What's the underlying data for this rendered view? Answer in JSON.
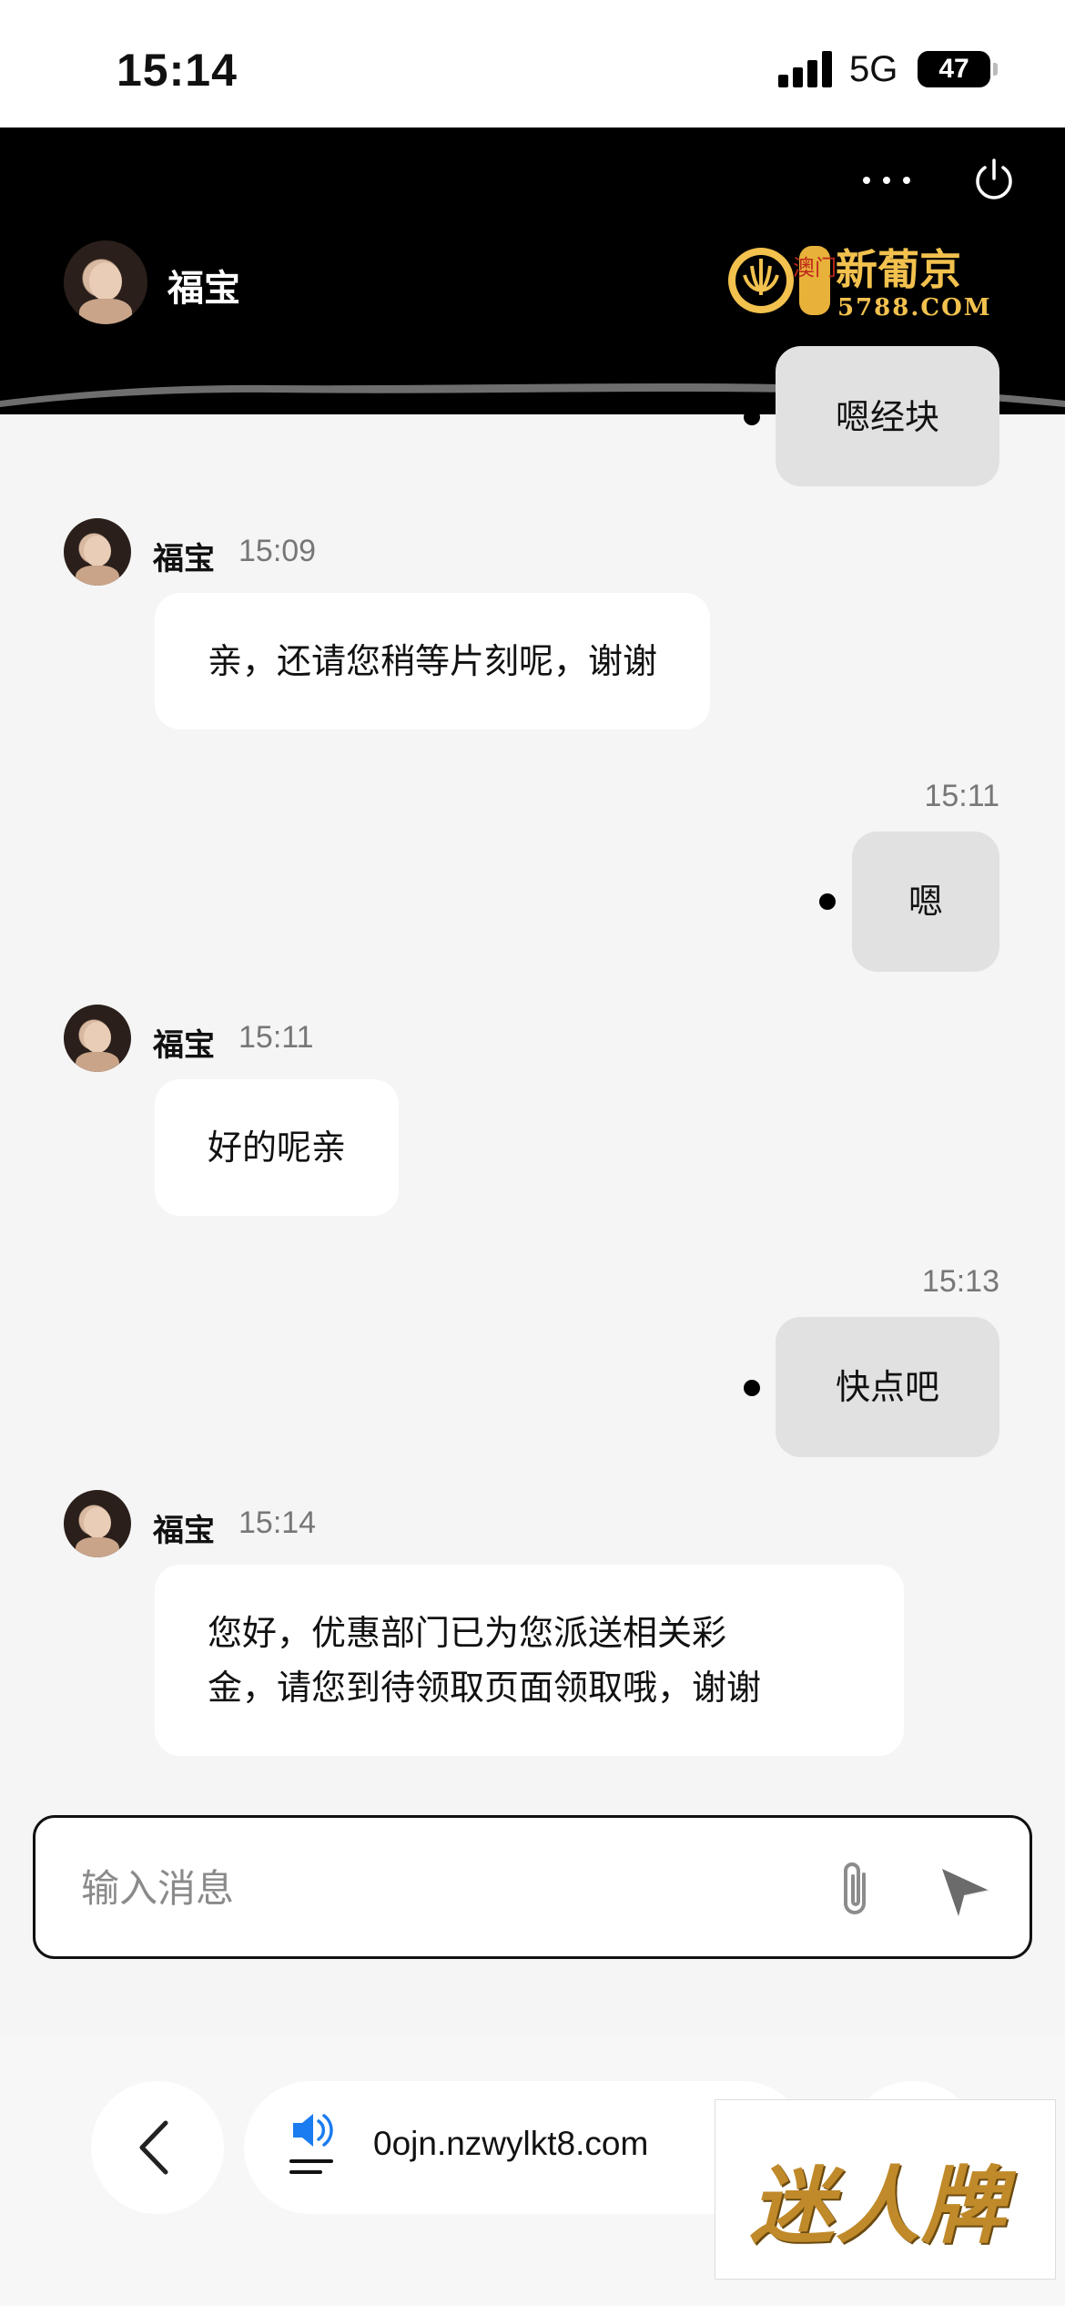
{
  "status_bar": {
    "time": "15:14",
    "network": "5G",
    "battery": "47"
  },
  "header": {
    "agent_name": "福宝",
    "brand_name": "新葡京",
    "brand_url": "5788.COM",
    "brand_seal": "澳门"
  },
  "messages": [
    {
      "from": "user",
      "text": "嗯经块"
    },
    {
      "from": "agent",
      "name": "福宝",
      "time": "15:09",
      "text": "亲，还请您稍等片刻呢，谢谢"
    },
    {
      "from": "user",
      "time": "15:11",
      "text": "嗯"
    },
    {
      "from": "agent",
      "name": "福宝",
      "time": "15:11",
      "text": "好的呢亲"
    },
    {
      "from": "user",
      "time": "15:13",
      "text": "快点吧"
    },
    {
      "from": "agent",
      "name": "福宝",
      "time": "15:14",
      "text_line1": "您好，优惠部门已为您派送相关彩",
      "text_line2": "金，请您到待领取页面领取哦，谢谢"
    }
  ],
  "input": {
    "placeholder": "输入消息"
  },
  "browser": {
    "url": "0ojn.nzwylkt8.com"
  },
  "watermark": {
    "text": "迷人牌"
  },
  "icons": {
    "more": "more-dots-icon",
    "power": "power-icon",
    "attach": "paperclip-icon",
    "send": "send-icon",
    "back": "chevron-left-icon",
    "speaker": "speaker-icon"
  },
  "colors": {
    "header_bg": "#000000",
    "agent_bubble": "#ffffff",
    "user_bubble": "#e1e1e1",
    "brand_gold": "#f2c14e",
    "speaker_blue": "#1a7cf0"
  }
}
